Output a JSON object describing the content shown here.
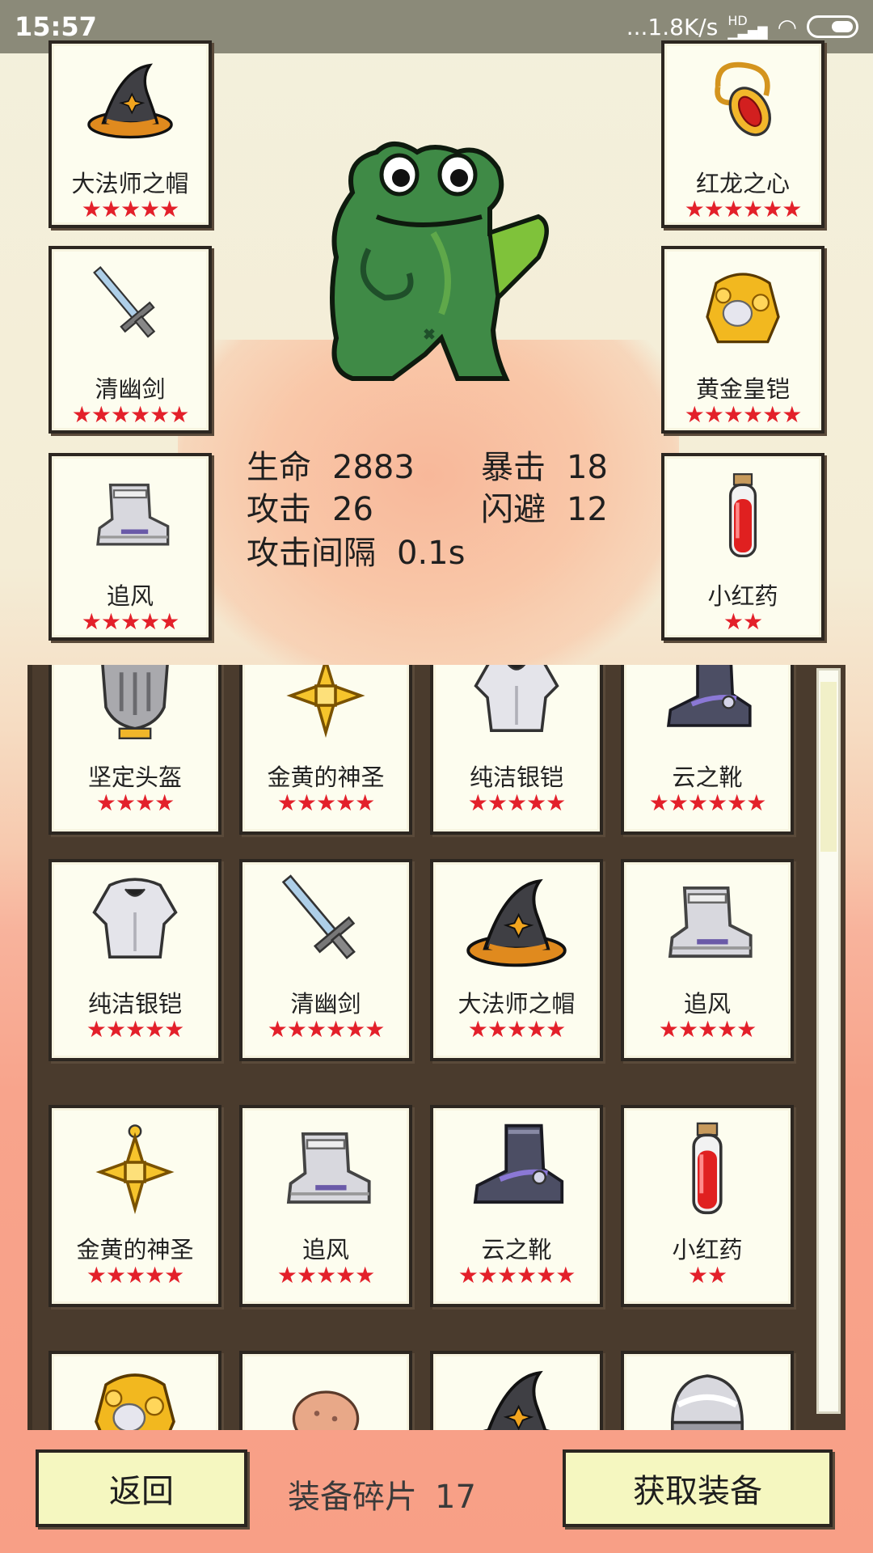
{
  "status_bar": {
    "time": "15:57",
    "network": "...1.8K/s",
    "hd": "HD"
  },
  "hero": {
    "stats": [
      {
        "key": "生命",
        "value": "2883"
      },
      {
        "key": "暴击",
        "value": "18"
      },
      {
        "key": "攻击",
        "value": "26"
      },
      {
        "key": "闪避",
        "value": "12"
      },
      {
        "key": "攻击间隔",
        "value": "0.1s"
      }
    ]
  },
  "equipped": {
    "left": [
      {
        "name": "大法师之帽",
        "stars": "★★★★★",
        "icon": "wizard-hat-icon"
      },
      {
        "name": "清幽剑",
        "stars": "★★★★★★",
        "icon": "sword-icon"
      },
      {
        "name": "追风",
        "stars": "★★★★★",
        "icon": "silver-boot-icon"
      }
    ],
    "right": [
      {
        "name": "红龙之心",
        "stars": "★★★★★★",
        "icon": "amulet-icon"
      },
      {
        "name": "黄金皇铠",
        "stars": "★★★★★★",
        "icon": "golden-armor-icon"
      },
      {
        "name": "小红药",
        "stars": "★★",
        "icon": "red-potion-icon"
      }
    ]
  },
  "inventory": {
    "rows": [
      [
        {
          "name": "坚定头盔",
          "stars": "★★★★",
          "icon": "helmet-icon"
        },
        {
          "name": "金黄的神圣",
          "stars": "★★★★★",
          "icon": "golden-cross-icon"
        },
        {
          "name": "纯洁银铠",
          "stars": "★★★★★",
          "icon": "silver-armor-icon"
        },
        {
          "name": "云之靴",
          "stars": "★★★★★★",
          "icon": "dark-boot-icon"
        }
      ],
      [
        {
          "name": "纯洁银铠",
          "stars": "★★★★★",
          "icon": "silver-armor-icon"
        },
        {
          "name": "清幽剑",
          "stars": "★★★★★★",
          "icon": "sword-icon"
        },
        {
          "name": "大法师之帽",
          "stars": "★★★★★",
          "icon": "wizard-hat-icon"
        },
        {
          "name": "追风",
          "stars": "★★★★★",
          "icon": "silver-boot-icon"
        }
      ],
      [
        {
          "name": "金黄的神圣",
          "stars": "★★★★★",
          "icon": "golden-cross-icon"
        },
        {
          "name": "追风",
          "stars": "★★★★★",
          "icon": "silver-boot-icon"
        },
        {
          "name": "云之靴",
          "stars": "★★★★★★",
          "icon": "dark-boot-icon"
        },
        {
          "name": "小红药",
          "stars": "★★",
          "icon": "red-potion-icon"
        }
      ],
      [
        {
          "name": "",
          "stars": "",
          "icon": "golden-armor-icon"
        },
        {
          "name": "",
          "stars": "",
          "icon": "bread-icon"
        },
        {
          "name": "",
          "stars": "",
          "icon": "wizard-hat-icon"
        },
        {
          "name": "",
          "stars": "",
          "icon": "silver-helmet-icon"
        }
      ]
    ]
  },
  "bottom": {
    "back_label": "返回",
    "shards_label": "装备碎片",
    "shards_value": "17",
    "obtain_label": "获取装备"
  }
}
